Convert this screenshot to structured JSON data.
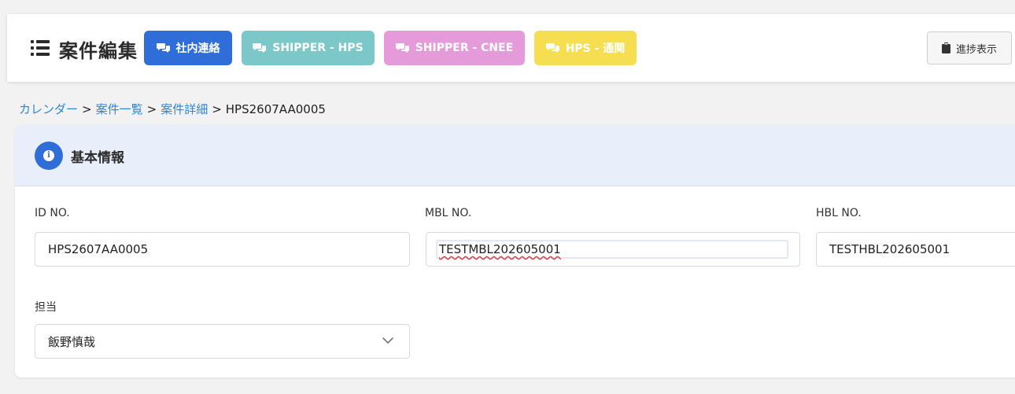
{
  "header": {
    "title": "案件編集",
    "chat_buttons": [
      {
        "label": "社内連絡",
        "color": "#2f6ed8"
      },
      {
        "label": "SHIPPER - HPS",
        "color": "#7cc8c9"
      },
      {
        "label": "SHIPPER - CNEE",
        "color": "#e59bd9"
      },
      {
        "label": "HPS - 通関",
        "color": "#f5df51"
      }
    ],
    "progress_button": {
      "label": "進捗表示"
    }
  },
  "breadcrumb": {
    "items": [
      "カレンダー",
      "案件一覧",
      "案件詳細"
    ],
    "separator": ">",
    "current": "HPS2607AA0005"
  },
  "section": {
    "title": "基本情報",
    "fields": {
      "id_no": {
        "label": "ID NO.",
        "value": "HPS2607AA0005"
      },
      "mbl_no": {
        "label": "MBL NO.",
        "value": "TESTMBL202605001"
      },
      "hbl_no": {
        "label": "HBL NO.",
        "value": "TESTHBL202605001"
      },
      "assignee": {
        "label": "担当",
        "value": "飯野慎哉"
      }
    }
  }
}
